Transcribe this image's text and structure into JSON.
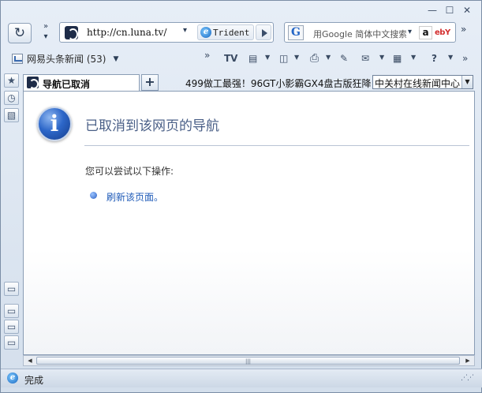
{
  "window": {
    "controls": {
      "minimize": "—",
      "maximize": "☐",
      "close": "✕"
    }
  },
  "navbar": {
    "refresh_glyph": "↻",
    "more_glyph": "»",
    "url": "http://cn.luna.tv/",
    "engine_label": "Trident",
    "search_placeholder": "用Google 简体中文搜索",
    "amazon_label": "a",
    "ebay_label": "ebY",
    "overflow_glyph": "»"
  },
  "toolbar": {
    "feed_label": "网易头条新闻 (53)",
    "more_glyph": "»",
    "icons": [
      "tv-icon",
      "page-icon",
      "new-window-icon",
      "print-icon",
      "tools-icon",
      "mail-icon",
      "layout-icon",
      "help-icon"
    ],
    "help_glyph": "?"
  },
  "tabs": {
    "active_label": "导航已取消",
    "new_tab_glyph": "+",
    "ticker": "499做工最强！96GT小影霸GX4盘古版狂降",
    "news_source": "中关村在线新闻中心"
  },
  "page": {
    "title": "已取消到该网页的导航",
    "hint": "您可以尝试以下操作:",
    "refresh_link": "刷新该页面。"
  },
  "status": {
    "text": "完成"
  },
  "colors": {
    "accent": "#2d67c9",
    "title_text": "#4a5f87",
    "link": "#1f5bb8"
  }
}
